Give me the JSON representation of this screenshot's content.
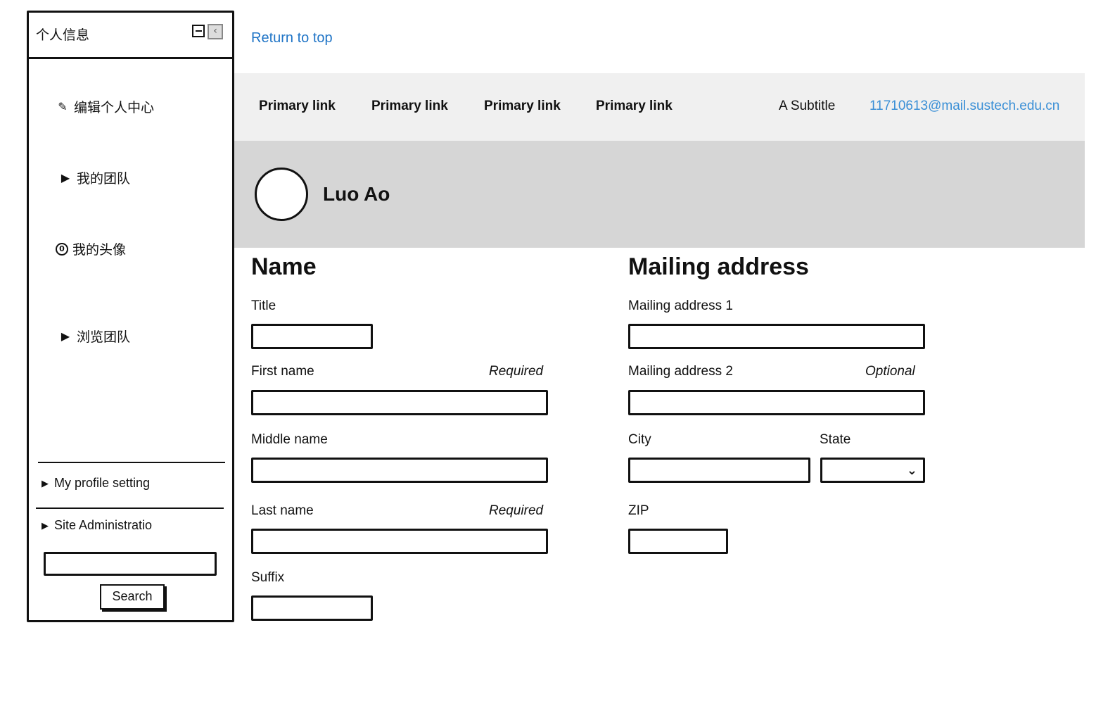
{
  "sidebar": {
    "title": "个人信息",
    "collapse_icon": "collapse-icon",
    "scroll_icon": "scroll-left-icon",
    "items": [
      {
        "label": "编辑个人中心",
        "icon": "pencil-icon"
      },
      {
        "label": "我的团队",
        "icon": "triangle-right-icon"
      },
      {
        "label": "我的头像",
        "icon": "avatar-ring-icon"
      },
      {
        "label": "浏览团队",
        "icon": "triangle-right-icon"
      }
    ],
    "sub_items": [
      {
        "label": "My profile setting"
      },
      {
        "label": "Site Administratio"
      }
    ],
    "search": {
      "placeholder": "",
      "button_label": "Search"
    }
  },
  "return_top": "Return to top",
  "navbar": {
    "links": [
      "Primary link",
      "Primary link",
      "Primary link",
      "Primary link"
    ],
    "subtitle": "A Subtitle",
    "email": "11710613@mail.sustech.edu.cn"
  },
  "profile": {
    "name": "Luo Ao"
  },
  "name_section": {
    "title": "Name",
    "title_label": "Title",
    "first_name_label": "First name",
    "first_name_hint": "Required",
    "middle_name_label": "Middle name",
    "last_name_label": "Last name",
    "last_name_hint": "Required",
    "suffix_label": "Suffix"
  },
  "address_section": {
    "title": "Mailing address",
    "address1_label": "Mailing address 1",
    "address2_label": "Mailing address 2",
    "address2_hint": "Optional",
    "city_label": "City",
    "state_label": "State",
    "zip_label": "ZIP"
  },
  "colors": {
    "link": "#1f74c6",
    "email": "#3a8fd6",
    "navbar_bg": "#f0f0f0",
    "banner_bg": "#d6d6d6"
  }
}
